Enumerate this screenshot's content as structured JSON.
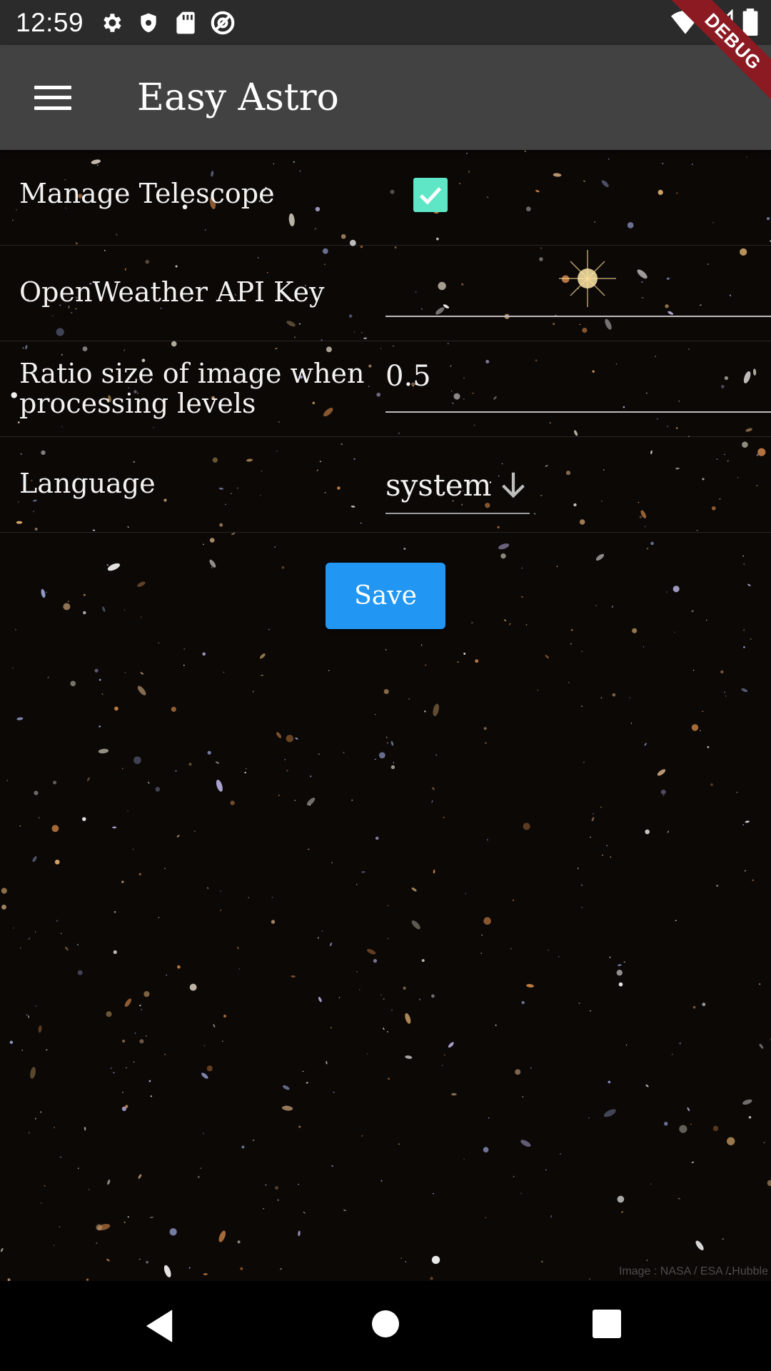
{
  "status_bar": {
    "time": "12:59",
    "left_icons": [
      "settings-icon",
      "shield-icon",
      "sd-card-icon",
      "at-sign-icon"
    ],
    "right_icons": [
      "wifi-icon",
      "cell-signal-icon",
      "battery-icon"
    ]
  },
  "debug_banner": "DEBUG",
  "app_bar": {
    "title": "Easy Astro",
    "menu_icon": "menu-icon"
  },
  "settings": {
    "manage_telescope": {
      "label": "Manage Telescope",
      "checked": true
    },
    "openweather_api_key": {
      "label": "OpenWeather API Key",
      "value": ""
    },
    "image_ratio": {
      "label_line1": "Ratio size of image when",
      "label_line2": "processing levels",
      "value": "0.5"
    },
    "language": {
      "label": "Language",
      "value": "system",
      "icon": "arrow-down-icon"
    }
  },
  "save_label": "Save",
  "credit": "Image : NASA / ESA / Hubble",
  "nav_bar": {
    "icons": [
      "back-icon",
      "home-icon",
      "recents-icon"
    ]
  },
  "colors": {
    "app_bar": "#424242",
    "checkbox": "#5fe6c7",
    "save_button": "#2196f3",
    "debug_ribbon": "#8c1a22"
  }
}
